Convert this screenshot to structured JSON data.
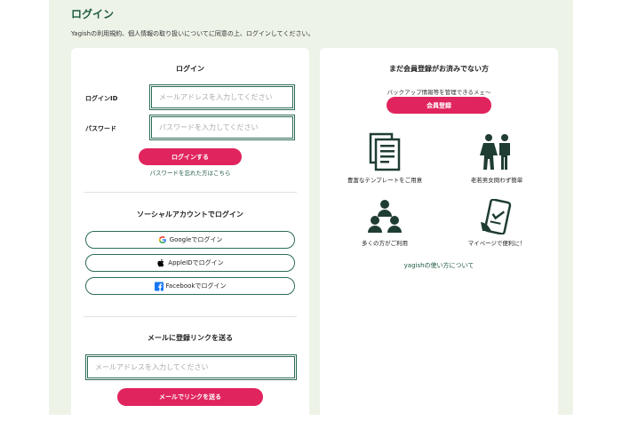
{
  "page": {
    "title": "ログイン",
    "notice": "Yagishの利用規約、個人情報の取り扱いについてに同意の上、ログインしてください。"
  },
  "login": {
    "heading": "ログイン",
    "id_label": "ログインID",
    "id_placeholder": "メールアドレスを入力してください",
    "password_label": "パスワード",
    "password_placeholder": "パスワードを入力してください",
    "submit": "ログインする",
    "forgot": "パスワードを忘れた方はこちら"
  },
  "social": {
    "heading": "ソーシャルアカウントでログイン",
    "google": "Googleでログイン",
    "apple": "AppleIDでログイン",
    "facebook": "Facebookでログイン"
  },
  "mail_link": {
    "heading": "メールに登録リンクを送る",
    "placeholder": "メールアドレスを入力してください",
    "submit": "メールでリンクを送る"
  },
  "register": {
    "heading": "まだ会員登録がお済みでない方",
    "lead": "バックアップ情報等を管理できるメェ〜",
    "button": "会員登録",
    "features": [
      {
        "icon": "document-icon",
        "caption": "豊富なテンプレートをご用意"
      },
      {
        "icon": "man-woman-icon",
        "caption": "老若男女問わず簡単"
      },
      {
        "icon": "people-group-icon",
        "caption": "多くの方がご利用"
      },
      {
        "icon": "smartphone-check-icon",
        "caption": "マイページで便利に！"
      }
    ],
    "how_to": "yagishの使い方について"
  },
  "colors": {
    "accent": "#e0245e",
    "brand": "#1f5a3f",
    "background": "#eef3e8"
  }
}
